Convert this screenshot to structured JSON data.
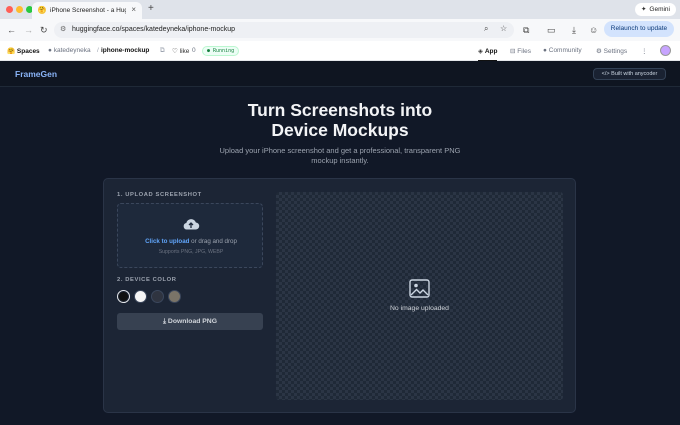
{
  "browser": {
    "tab_title": "iPhone Screenshot - a Hugg",
    "tab_close": "×",
    "new_tab": "+",
    "gemini_label": "Gemini",
    "url": "huggingface.co/spaces/katedeyneka/iphone-mockup",
    "relaunch_label": "Relaunch to update",
    "colors": {
      "tab_strip": "#dfe3ea",
      "relaunch_bg": "#d3e3fd"
    }
  },
  "hf_header": {
    "spaces_label": "Spaces",
    "owner": "katedeyneka",
    "separator": "/",
    "repo": "iphone-mockup",
    "like_label": "like",
    "like_count": "0",
    "status": "Running",
    "nav": {
      "app": "App",
      "files": "Files",
      "community": "Community",
      "settings": "Settings",
      "more": "⋮"
    }
  },
  "app": {
    "brand": "FrameGen",
    "built_with": "Built with anycoder",
    "hero_line1": "Turn Screenshots into",
    "hero_line2": "Device Mockups",
    "subtitle_line1": "Upload your iPhone screenshot and get a professional, transparent PNG",
    "subtitle_line2": "mockup instantly.",
    "upload_section_label": "1. UPLOAD SCREENSHOT",
    "upload_link": "Click to upload",
    "upload_rest": " or drag and drop",
    "upload_formats": "Supports PNG, JPG, WEBP",
    "color_section_label": "2. DEVICE COLOR",
    "device_colors": [
      "#111111",
      "#f5f5f5",
      "#2f3440",
      "#7a7468"
    ],
    "selected_color_index": 0,
    "download_label": "Download PNG",
    "preview_empty": "No image uploaded",
    "colors": {
      "background": "#111827",
      "card": "#1c2535",
      "accent": "#60a5fa"
    }
  }
}
